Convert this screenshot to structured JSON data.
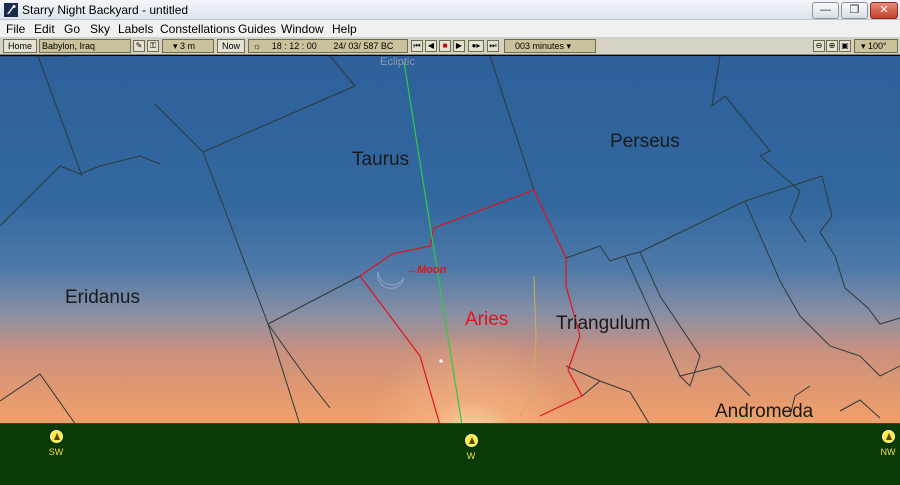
{
  "window": {
    "title": "Starry Night Backyard - untitled",
    "buttons": {
      "minimize": "—",
      "maximize": "❐",
      "close": "✕"
    }
  },
  "menu": [
    "File",
    "Edit",
    "Go",
    "Sky",
    "Labels",
    "Constellations",
    "Guides",
    "Window",
    "Help"
  ],
  "toolbar": {
    "home_label": "Home",
    "location": "Babylon, Iraq",
    "elevation": "▾ 3 m",
    "now_label": "Now",
    "time": "18 : 12 : 00",
    "date": "24/ 03/   587 BC",
    "time_step": "003 minutes ▾",
    "field_of_view": "▾ 100°"
  },
  "sky": {
    "ecliptic_label": "Ecliptic",
    "moon_label": "Moon",
    "constellations": [
      "Taurus",
      "Perseus",
      "Eridanus",
      "Aries",
      "Triangulum",
      "Andromeda"
    ],
    "selected_constellation": "Aries"
  },
  "horizon": {
    "directions": [
      "SW",
      "W",
      "NW"
    ]
  },
  "colors": {
    "selected": "#e0141c",
    "ecliptic": "#2ecc40",
    "ground": "#0a3a08",
    "compass": "#f0e04a"
  }
}
